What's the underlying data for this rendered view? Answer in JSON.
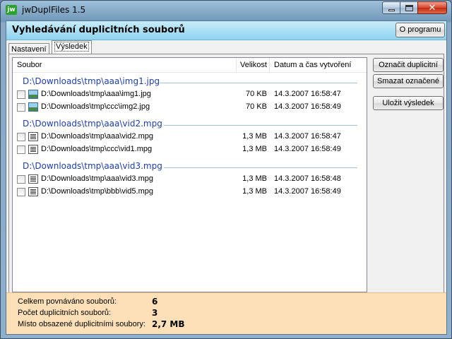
{
  "window": {
    "app_icon_text": "jw",
    "title": "jwDuplFiles 1.5"
  },
  "header": {
    "title": "Vyhledávání duplicitních souborů",
    "about_label": "O programu"
  },
  "tabs": [
    {
      "label": "Nastavení",
      "active": false
    },
    {
      "label": "Výsledek",
      "active": true
    }
  ],
  "list": {
    "columns": {
      "file": "Soubor",
      "size": "Velikost",
      "date": "Datum a čas vytvoření"
    },
    "groups": [
      {
        "title": "D:\\Downloads\\tmp\\aaa\\img1.jpg",
        "icon": "image-file-icon",
        "rows": [
          {
            "name": "D:\\Downloads\\tmp\\aaa\\img1.jpg",
            "size": "70 KB",
            "date": "14.3.2007 16:58:47"
          },
          {
            "name": "D:\\Downloads\\tmp\\ccc\\img2.jpg",
            "size": "70 KB",
            "date": "14.3.2007 16:58:49"
          }
        ]
      },
      {
        "title": "D:\\Downloads\\tmp\\aaa\\vid2.mpg",
        "icon": "video-file-icon",
        "rows": [
          {
            "name": "D:\\Downloads\\tmp\\aaa\\vid2.mpg",
            "size": "1,3 MB",
            "date": "14.3.2007 16:58:47"
          },
          {
            "name": "D:\\Downloads\\tmp\\ccc\\vid1.mpg",
            "size": "1,3 MB",
            "date": "14.3.2007 16:58:49"
          }
        ]
      },
      {
        "title": "D:\\Downloads\\tmp\\aaa\\vid3.mpg",
        "icon": "video-file-icon",
        "rows": [
          {
            "name": "D:\\Downloads\\tmp\\aaa\\vid3.mpg",
            "size": "1,3 MB",
            "date": "14.3.2007 16:58:48"
          },
          {
            "name": "D:\\Downloads\\tmp\\bbb\\vid5.mpg",
            "size": "1,3 MB",
            "date": "14.3.2007 16:58:49"
          }
        ]
      }
    ]
  },
  "actions": {
    "mark_duplicates": "Označit duplicitní",
    "delete_marked": "Smazat označené",
    "save_result": "Uložit výsledek"
  },
  "summary": {
    "compared_label": "Celkem povnáváno souborů:",
    "compared_value": "6",
    "duplicates_label": "Počet duplicitních souborů:",
    "duplicates_value": "3",
    "space_label": "Místo obsazené duplicitními soubory:",
    "space_value": "2,7 MB"
  }
}
